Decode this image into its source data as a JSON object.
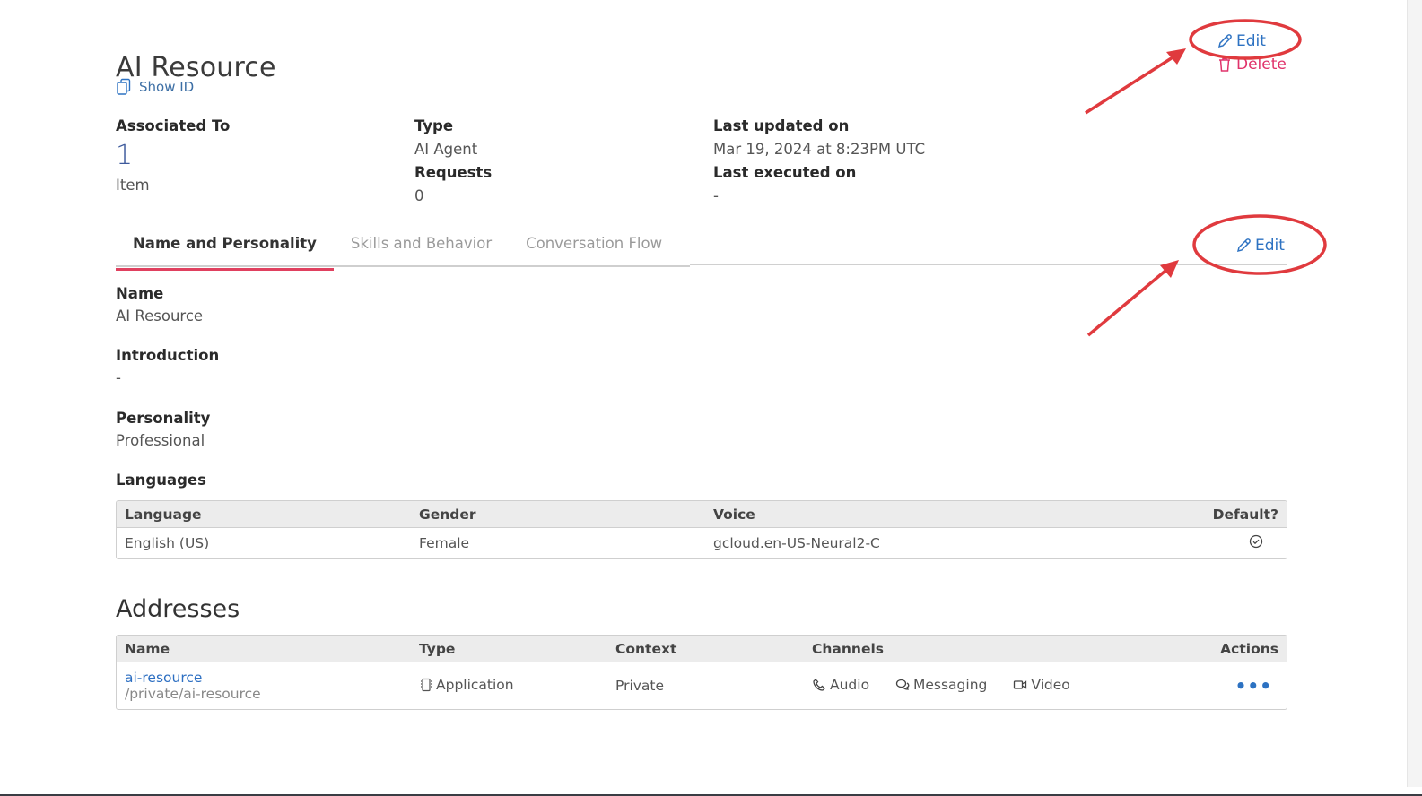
{
  "page": {
    "title": "AI Resource",
    "show_id_label": "Show ID",
    "edit_label": "Edit",
    "delete_label": "Delete"
  },
  "meta": {
    "associated_to": {
      "label": "Associated To",
      "value": "1",
      "unit": "Item"
    },
    "type": {
      "label": "Type",
      "value": "AI Agent"
    },
    "requests": {
      "label": "Requests",
      "value": "0"
    },
    "last_updated": {
      "label": "Last updated on",
      "value": "Mar 19, 2024 at 8:23PM UTC"
    },
    "last_executed": {
      "label": "Last executed on",
      "value": "-"
    }
  },
  "tabs": [
    {
      "label": "Name and Personality",
      "active": true
    },
    {
      "label": "Skills and Behavior",
      "active": false
    },
    {
      "label": "Conversation Flow",
      "active": false
    }
  ],
  "section_edit_label": "Edit",
  "fields": {
    "name": {
      "label": "Name",
      "value": "AI Resource"
    },
    "introduction": {
      "label": "Introduction",
      "value": "-"
    },
    "personality": {
      "label": "Personality",
      "value": "Professional"
    },
    "languages_label": "Languages"
  },
  "languages_table": {
    "headers": [
      "Language",
      "Gender",
      "Voice",
      "Default?"
    ],
    "rows": [
      {
        "language": "English (US)",
        "gender": "Female",
        "voice": "gcloud.en-US-Neural2-C",
        "default": true
      }
    ]
  },
  "addresses": {
    "title": "Addresses",
    "headers": [
      "Name",
      "Type",
      "Context",
      "Channels",
      "Actions"
    ],
    "rows": [
      {
        "name": "ai-resource",
        "path": "/private/ai-resource",
        "type": "Application",
        "context": "Private",
        "channels": [
          "Audio",
          "Messaging",
          "Video"
        ],
        "actions_icon": "more-icon"
      }
    ]
  },
  "colors": {
    "accent_blue": "#2d72c2",
    "delete_pink": "#e0336b",
    "active_tab_underline": "#e0405f",
    "annotation_red": "#e03a3e"
  }
}
